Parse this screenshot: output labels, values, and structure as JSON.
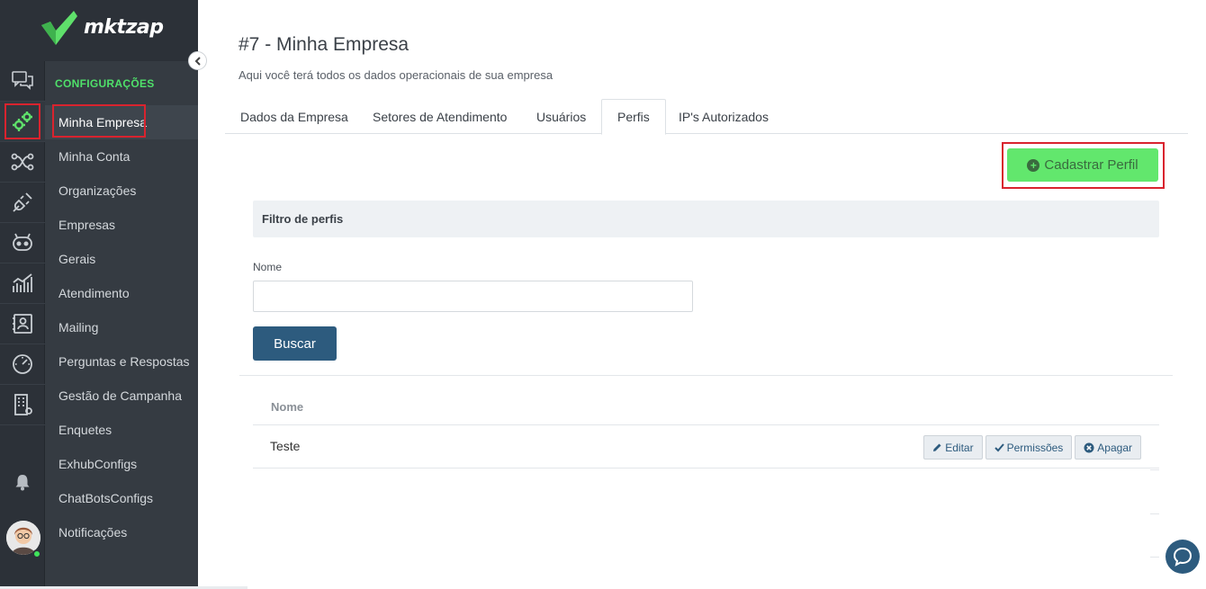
{
  "brand": {
    "name": "mktzap"
  },
  "rail": {
    "items": [
      "chat-icon",
      "gears-icon",
      "flow-icon",
      "plug-icon",
      "bot-icon",
      "stats-icon",
      "contacts-icon",
      "gauge-icon",
      "building-icon"
    ],
    "bell": "bell-icon",
    "avatar": "user-avatar"
  },
  "menu": {
    "title": "CONFIGURAÇÕES",
    "items": [
      "Minha Empresa",
      "Minha Conta",
      "Organizações",
      "Empresas",
      "Gerais",
      "Atendimento",
      "Mailing",
      "Perguntas e Respostas",
      "Gestão de Campanha",
      "Enquetes",
      "ExhubConfigs",
      "ChatBotsConfigs",
      "Notificações"
    ],
    "active_index": 0
  },
  "page": {
    "title": "#7 - Minha Empresa",
    "subtitle": "Aqui você terá todos os dados operacionais de sua empresa"
  },
  "tabs": [
    "Dados da Empresa",
    "Setores de Atendimento",
    "Usuários",
    "Perfis",
    "IP's Autorizados"
  ],
  "active_tab": "Perfis",
  "new_button": "Cadastrar Perfil",
  "filter": {
    "title": "Filtro de perfis",
    "name_label": "Nome",
    "name_value": "",
    "search_button": "Buscar"
  },
  "table": {
    "header": "Nome",
    "rows": [
      {
        "name": "Teste"
      }
    ],
    "actions": {
      "edit": "Editar",
      "permissions": "Permissões",
      "delete": "Apagar"
    }
  },
  "colors": {
    "sidebar": "#2c3138",
    "menu": "#353b42",
    "accent_green": "#62e76d",
    "primary_blue": "#2d5b7e",
    "highlight_red": "#d9232e"
  }
}
